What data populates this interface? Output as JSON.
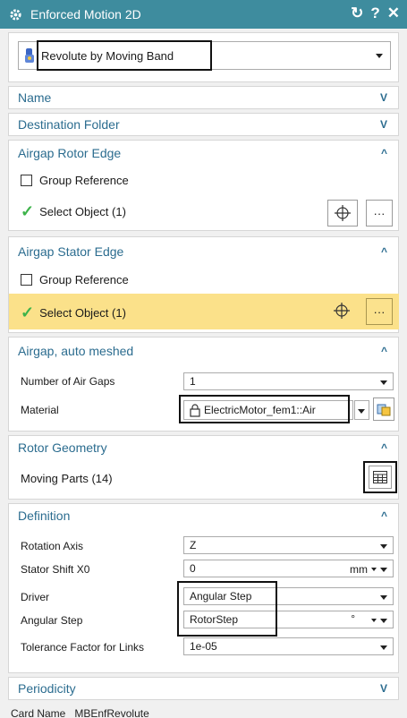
{
  "window": {
    "title": "Enforced Motion 2D",
    "controls": [
      "↻",
      "?",
      "✕"
    ]
  },
  "type_selector": {
    "value": "Revolute by Moving Band"
  },
  "sections": {
    "name": {
      "label": "Name",
      "state": "collapsed"
    },
    "destination": {
      "label": "Destination Folder",
      "state": "collapsed"
    },
    "rotor_edge": {
      "label": "Airgap Rotor Edge",
      "group_reference": "Group Reference",
      "select_object": "Select Object (1)"
    },
    "stator_edge": {
      "label": "Airgap Stator Edge",
      "group_reference": "Group Reference",
      "select_object": "Select Object (1)"
    },
    "airgap_meshed": {
      "label": "Airgap, auto meshed",
      "num_gaps_label": "Number of Air Gaps",
      "num_gaps_value": "1",
      "material_label": "Material",
      "material_value": "ElectricMotor_fem1::Air"
    },
    "rotor_geometry": {
      "label": "Rotor Geometry",
      "moving_parts": "Moving Parts (14)"
    },
    "definition": {
      "label": "Definition",
      "rotation_axis_label": "Rotation Axis",
      "rotation_axis_value": "Z",
      "stator_shift_label": "Stator Shift X0",
      "stator_shift_value": "0",
      "stator_shift_unit": "mm",
      "driver_label": "Driver",
      "driver_value": "Angular Step",
      "angular_step_label": "Angular Step",
      "angular_step_value": "RotorStep",
      "angular_step_unit": "°",
      "tolerance_label": "Tolerance Factor for Links",
      "tolerance_value": "1e-05"
    },
    "periodicity": {
      "label": "Periodicity",
      "state": "collapsed"
    }
  },
  "footer": {
    "card_name_label": "Card Name",
    "card_name_value": "MBEnfRevolute"
  },
  "colors": {
    "titlebar": "#3e8c9e",
    "section_header": "#2b6c8f",
    "highlight": "#fbe18a",
    "check": "#3db34a"
  }
}
